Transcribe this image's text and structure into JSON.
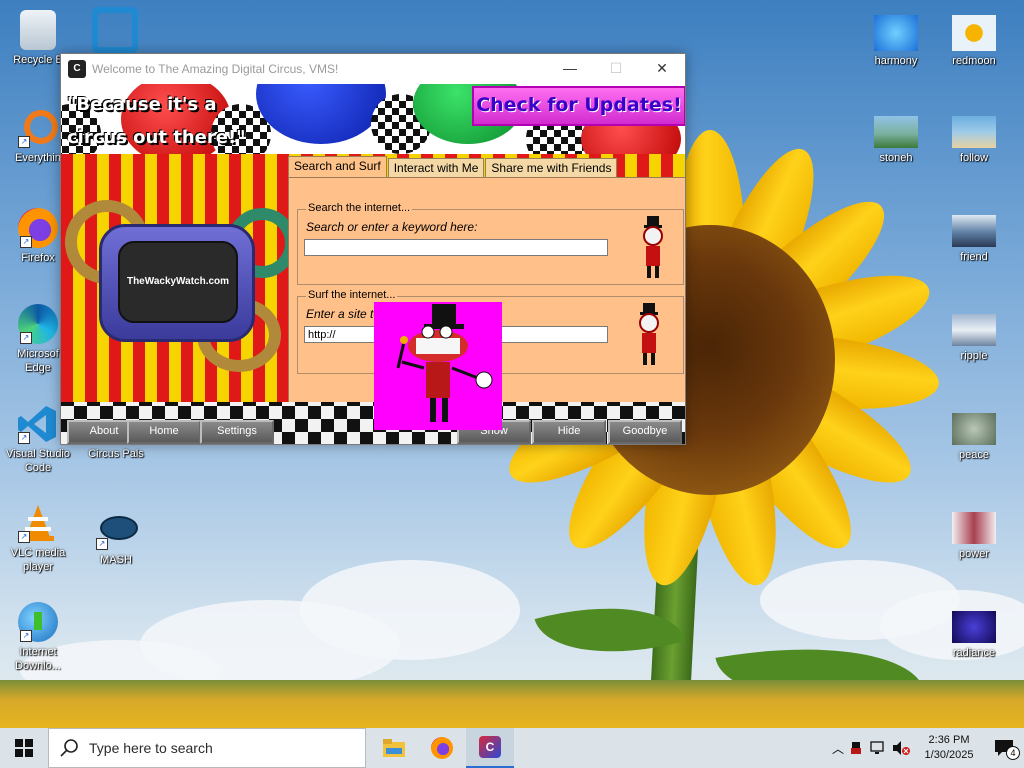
{
  "desktop": {
    "left_icons": [
      {
        "label": "Recycle Bin",
        "display": "Recycle B",
        "icon": "recycle-bin-icon"
      },
      {
        "label": "Everything",
        "display": "Everythin",
        "icon": "everything-search-icon"
      },
      {
        "label": "Firefox",
        "icon": "firefox-icon"
      },
      {
        "label": "Microsoft Edge",
        "display1": "Microsof",
        "display2": "Edge",
        "icon": "edge-icon"
      },
      {
        "label1": "Visual Studio",
        "label2": "Code",
        "icon": "vscode-icon"
      },
      {
        "label": "Circus Pals",
        "icon": "circus-pals-icon"
      },
      {
        "label1": "VLC media",
        "label2": "player",
        "icon": "vlc-icon"
      },
      {
        "label": "MASH",
        "icon": "mash-icon"
      },
      {
        "label1": "Internet",
        "label2": "Downlo...",
        "icon": "internet-download-manager-icon"
      }
    ],
    "right_icons": [
      {
        "label": "harmony"
      },
      {
        "label": "redmoon"
      },
      {
        "label": "stoneh"
      },
      {
        "label": "follow"
      },
      {
        "label": "friend"
      },
      {
        "label": "ripple"
      },
      {
        "label": "peace"
      },
      {
        "label": "power"
      },
      {
        "label": "radiance"
      }
    ]
  },
  "window": {
    "title": "Welcome to The Amazing Digital Circus, VMS!",
    "app_icon_text": "C",
    "minimize": "—",
    "maximize": "☐",
    "close": "✕",
    "slogan_line1": "\"Because it's a",
    "slogan_line2": "circus out there!\"",
    "update_button": "Check for Updates!",
    "watch_brand": "TheWackyWatch.com",
    "tabs": [
      "Search and Surf",
      "Interact with Me",
      "Share me with Friends"
    ],
    "active_tab": 0,
    "search_group": {
      "legend": "Search the internet...",
      "prompt": "Search or enter a keyword here:",
      "value": ""
    },
    "surf_group": {
      "legend": "Surf the internet...",
      "prompt": "Enter a site to",
      "value": "http://"
    },
    "bottom_buttons": {
      "about": "About",
      "home": "Home",
      "settings": "Settings",
      "show": "Show",
      "hide": "Hide",
      "goodbye": "Goodbye"
    }
  },
  "taskbar": {
    "search_placeholder": "Type here to search",
    "apps": [
      "file-explorer-icon",
      "firefox-icon",
      "circus-app-icon"
    ],
    "time": "2:36 PM",
    "date": "1/30/2025",
    "notification_count": "4"
  },
  "colors": {
    "taskbar": "#dbe3e8",
    "panel": "#ffc08a",
    "caine_bg": "#ff00ff",
    "update_text": "#3a00c8"
  }
}
